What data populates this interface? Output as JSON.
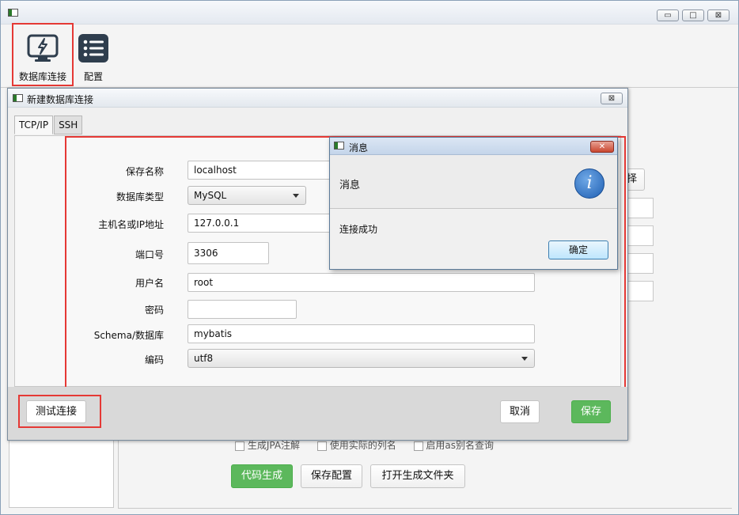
{
  "main_window": {
    "controls": {
      "minimize": "▭",
      "maximize": "□",
      "close": "⊠"
    }
  },
  "toolbar": {
    "db_connect_label": "数据库连接",
    "config_label": "配置"
  },
  "background": {
    "partial_button_text": "择",
    "checkboxes": [
      {
        "label": "生成JPA注解"
      },
      {
        "label": "使用实际的列名"
      },
      {
        "label": "启用as别名查询"
      }
    ],
    "buttons": {
      "generate": "代码生成",
      "save_config": "保存配置",
      "open_folder": "打开生成文件夹"
    }
  },
  "connection_dialog": {
    "title": "新建数据库连接",
    "close": "⊠",
    "tabs": [
      {
        "label": "TCP/IP"
      },
      {
        "label": "SSH"
      }
    ],
    "fields": {
      "save_name": {
        "label": "保存名称",
        "value": "localhost"
      },
      "db_type": {
        "label": "数据库类型",
        "value": "MySQL"
      },
      "host": {
        "label": "主机名或IP地址",
        "value": "127.0.0.1"
      },
      "port": {
        "label": "端口号",
        "value": "3306"
      },
      "username": {
        "label": "用户名",
        "value": "root"
      },
      "password": {
        "label": "密码",
        "value": ""
      },
      "schema": {
        "label": "Schema/数据库",
        "value": "mybatis"
      },
      "encoding": {
        "label": "编码",
        "value": "utf8"
      }
    },
    "footer": {
      "test": "测试连接",
      "cancel": "取消",
      "save": "保存"
    }
  },
  "message_box": {
    "title": "消息",
    "close": "✕",
    "header": "消息",
    "info_glyph": "i",
    "body": "连接成功",
    "ok": "确定"
  },
  "colors": {
    "highlight_red": "#e53935",
    "primary_green": "#5cb85c",
    "info_blue": "#1f5fb3"
  }
}
